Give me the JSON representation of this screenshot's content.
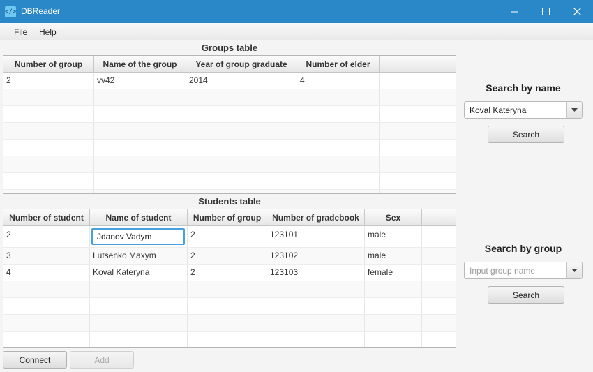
{
  "window": {
    "title": "DBReader",
    "icon": "code-icon"
  },
  "menu": [
    {
      "label": "File"
    },
    {
      "label": "Help"
    }
  ],
  "groups_table": {
    "title": "Groups table",
    "columns": [
      "Number of group",
      "Name of the group",
      "Year of group graduate",
      "Number of elder"
    ],
    "rows": [
      [
        "2",
        "vv42",
        "2014",
        "4"
      ]
    ]
  },
  "students_table": {
    "title": "Students table",
    "columns": [
      "Number of student",
      "Name of student",
      "Number of group",
      "Number of gradebook",
      "Sex"
    ],
    "rows": [
      [
        "2",
        "Jdanov Vadym",
        "2",
        "123101",
        "male"
      ],
      [
        "3",
        "Lutsenko Maxym",
        "2",
        "123102",
        "male"
      ],
      [
        "4",
        "Koval Kateryna",
        "2",
        "123103",
        "female"
      ]
    ],
    "editing_cell_value": "Jdanov Vadym"
  },
  "search_by_name": {
    "title": "Search by name",
    "selected": "Koval Kateryna",
    "button": "Search"
  },
  "search_by_group": {
    "title": "Search by group",
    "placeholder": "Input group name",
    "button": "Search"
  },
  "bottom_buttons": {
    "connect": "Connect",
    "add": "Add"
  },
  "colors": {
    "titlebar": "#2b88c8",
    "focus": "#49a0dc"
  }
}
